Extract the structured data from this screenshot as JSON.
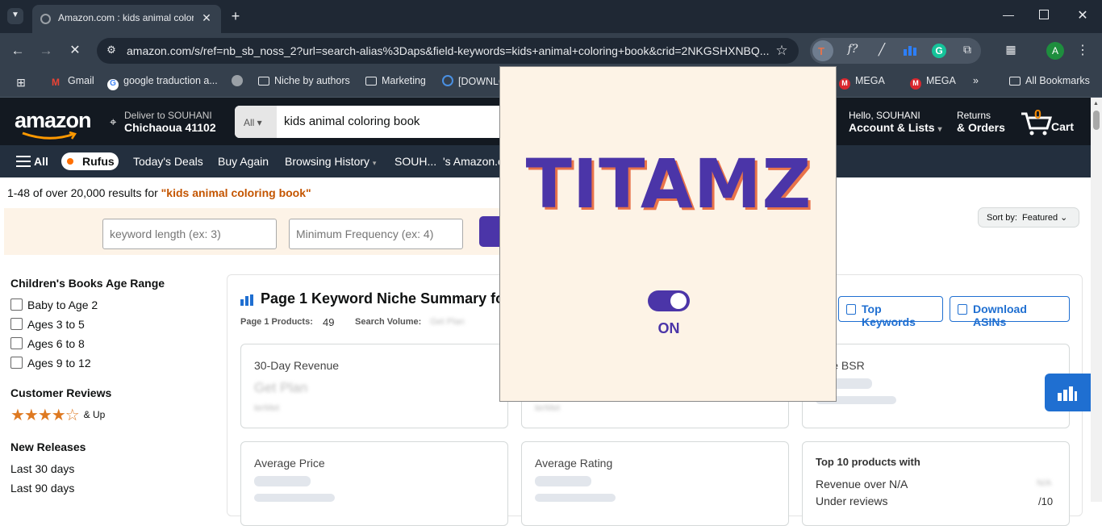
{
  "browser": {
    "tab_title": "Amazon.com : kids animal coloring book",
    "url": "amazon.com/s/ref=nb_sb_noss_2?url=search-alias%3Daps&field-keywords=kids+animal+coloring+book&crid=2NKGSHXNBQ...",
    "profile_initial": "A",
    "bookmarks": [
      "Gmail",
      "google traduction a...",
      "Niche by authors",
      "Marketing",
      "[DOWNLO",
      "MEGA",
      "MEGA",
      "All Bookmarks"
    ]
  },
  "amazon": {
    "deliver_line1": "Deliver to SOUHANI",
    "deliver_line2": "Chichaoua 41102",
    "search_category": "All",
    "search_value": "kids animal coloring book",
    "account_line1": "Hello, SOUHANI",
    "account_line2": "Account & Lists",
    "returns_line1": "Returns",
    "returns_line2": "& Orders",
    "cart_count": "0",
    "cart_label": "Cart",
    "nav": [
      "All",
      "Rufus",
      "Today's Deals",
      "Buy Again",
      "Browsing History",
      "SOUH...",
      "'s Amazon.c"
    ]
  },
  "results": {
    "prefix": "1-48 of over 20,000 results for ",
    "query": "\"kids animal coloring book\"",
    "sort_label": "Sort by:",
    "sort_value": "Featured"
  },
  "tool": {
    "keyword_length_placeholder": "keyword length (ex: 3)",
    "min_frequency_placeholder": "Minimum Frequency (ex: 4)"
  },
  "sidebar": {
    "age_heading": "Children's Books Age Range",
    "age_options": [
      "Baby to Age 2",
      "Ages 3 to 5",
      "Ages 6 to 8",
      "Ages 9 to 12"
    ],
    "reviews_heading": "Customer Reviews",
    "stars_label": "& Up",
    "stars_rating": 4,
    "releases_heading": "New Releases",
    "releases": [
      "Last 30 days",
      "Last 90 days"
    ]
  },
  "summary": {
    "title": "Page 1 Keyword Niche Summary fo",
    "products_label": "Page 1 Products:",
    "products_value": "49",
    "volume_label": "Search Volume:",
    "volume_value": "Get Plan",
    "top_keywords_button": "Top Keywords",
    "download_button": "Download ASINs",
    "cards": {
      "revenue_label": "30-Day Revenue",
      "revenue_value": "Get Plan",
      "revenue_sub": "terMet",
      "mid_sub": "terMet",
      "bsr_label": "rage BSR",
      "price_label": "Average Price",
      "rating_label": "Average Rating",
      "top10_label": "Top 10 products with",
      "top10_row1": "Revenue over N/A",
      "top10_row1_val": "N/A",
      "top10_row2": "Under reviews",
      "top10_row2_val": "/10"
    }
  },
  "popup": {
    "brand": "TITAMZ",
    "toggle_state": "ON"
  }
}
